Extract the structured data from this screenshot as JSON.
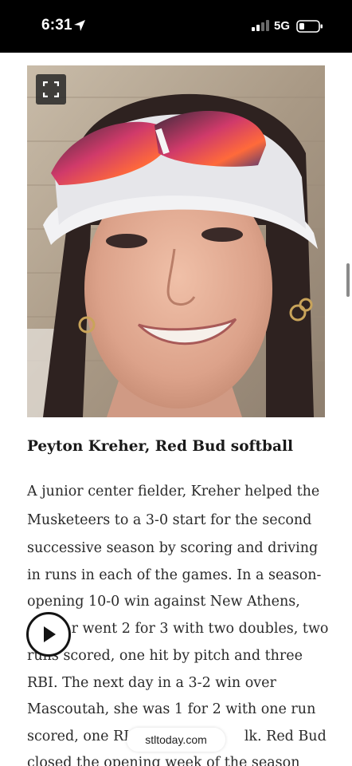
{
  "status_bar": {
    "time": "6:31",
    "network": "5G"
  },
  "article": {
    "headline": "Peyton Kreher, Red Bud softball",
    "lines": [
      "A junior center fielder, Kreher helped the",
      "Musketeers to a 3-0 start for the second",
      "successive season by scoring and driving",
      "in runs in each of the games. In a season-",
      "opening 10-0 win against New Athens,",
      "          r went 2 for 3 with two doubles, two",
      "runs scored, one hit by pitch and three",
      "RBI. The next day in a 3-2 win over",
      "Mascoutah, she was 1 for 2 with one run",
      "scored, one RI                          lk. Red Bud",
      "closed the opening week of the season"
    ]
  },
  "source_pill": "stltoday.com",
  "icons": {
    "location": "location-arrow-icon",
    "signal": "cellular-signal-icon",
    "battery": "battery-icon",
    "expand": "expand-fullscreen-icon",
    "play": "play-icon"
  },
  "colors": {
    "status_bar_bg": "#000000",
    "text": "#2a2a2a"
  }
}
